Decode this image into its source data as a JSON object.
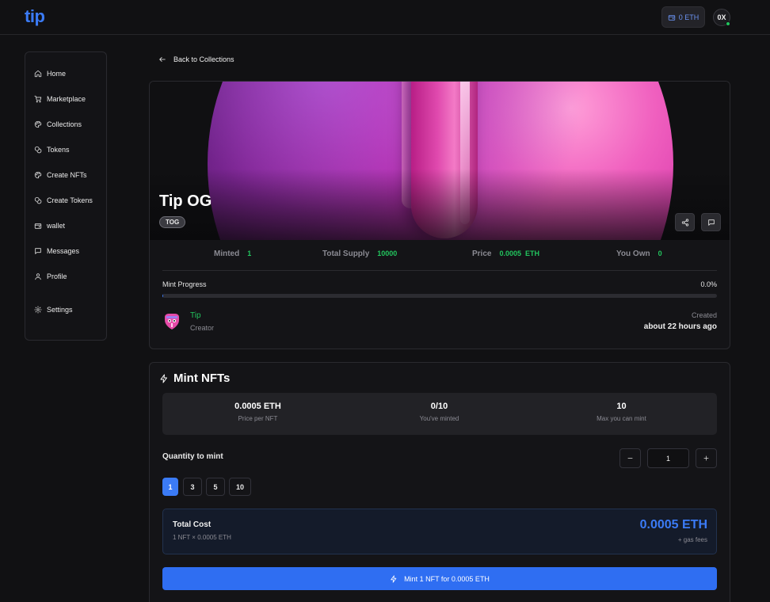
{
  "header": {
    "logo": "tip",
    "balance": "0 ETH",
    "avatar_initials": "0X",
    "wallet_icon": "wallet-icon"
  },
  "sidebar": {
    "items": [
      {
        "label": "Home",
        "icon": "home-icon"
      },
      {
        "label": "Marketplace",
        "icon": "cart-icon"
      },
      {
        "label": "Collections",
        "icon": "palette-icon"
      },
      {
        "label": "Tokens",
        "icon": "coins-icon"
      },
      {
        "label": "Create NFTs",
        "icon": "palette-icon"
      },
      {
        "label": "Create Tokens",
        "icon": "coins-icon"
      },
      {
        "label": "wallet",
        "icon": "wallet-icon"
      },
      {
        "label": "Messages",
        "icon": "message-icon"
      },
      {
        "label": "Profile",
        "icon": "user-icon"
      },
      {
        "label": "Settings",
        "icon": "gear-icon"
      }
    ]
  },
  "back_link": "Back to Collections",
  "collection": {
    "name": "Tip OG",
    "symbol": "TOG",
    "stats": {
      "minted_label": "Minted",
      "minted_value": "1",
      "supply_label": "Total Supply",
      "supply_value": "10000",
      "price_label": "Price",
      "price_value": "0.0005",
      "price_unit": "ETH",
      "owned_label": "You Own",
      "owned_value": "0"
    },
    "progress_label": "Mint Progress",
    "progress_pct": "0.0%",
    "progress_fraction": 0.0001,
    "creator_name": "Tip",
    "creator_role": "Creator",
    "created_label": "Created",
    "created_value": "about 22 hours ago"
  },
  "mint": {
    "title": "Mint NFTs",
    "info": [
      {
        "value": "0.0005 ETH",
        "label": "Price per NFT"
      },
      {
        "value": "0/10",
        "label": "You've minted"
      },
      {
        "value": "10",
        "label": "Max you can mint"
      }
    ],
    "quantity_label": "Quantity to mint",
    "quantity_value": "1",
    "presets": [
      "1",
      "3",
      "5",
      "10"
    ],
    "total_label": "Total Cost",
    "total_sub": "1 NFT × 0.0005 ETH",
    "total_value": "0.0005 ETH",
    "gas_note": "+ gas fees",
    "button_label": "Mint 1 NFT for 0.0005 ETH"
  },
  "colors": {
    "accent": "#3b7bf6",
    "success": "#22c55e",
    "background": "#111113",
    "card": "#141417"
  }
}
